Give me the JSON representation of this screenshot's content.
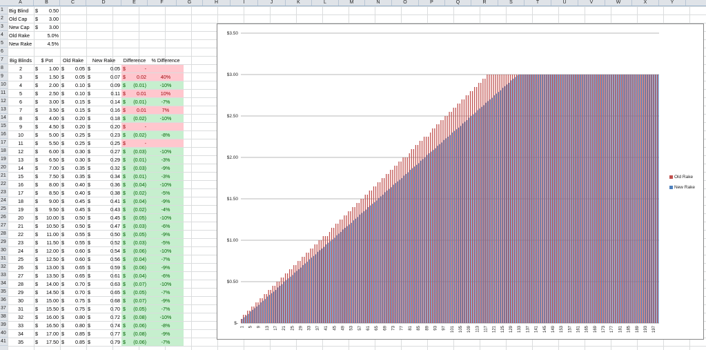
{
  "spreadsheet": {
    "columns": [
      "A",
      "B",
      "C",
      "D",
      "E",
      "F",
      "G",
      "H",
      "I",
      "J",
      "K",
      "L",
      "M",
      "N",
      "O",
      "P",
      "Q",
      "R",
      "S",
      "T",
      "U",
      "V",
      "W",
      "X",
      "Y"
    ],
    "rows": [
      "1",
      "2",
      "3",
      "4",
      "5",
      "6",
      "7",
      "8",
      "9",
      "10",
      "11",
      "12",
      "13",
      "14",
      "15",
      "16",
      "17",
      "18",
      "19",
      "20",
      "21",
      "22",
      "23",
      "24",
      "25",
      "26",
      "27",
      "28",
      "29",
      "30",
      "31",
      "32",
      "33",
      "34",
      "35",
      "36",
      "37",
      "38",
      "39",
      "40",
      "41"
    ],
    "params": [
      {
        "label": "Big Blind",
        "cur": "$",
        "val": "0.50"
      },
      {
        "label": "Old Cap",
        "cur": "$",
        "val": "3.00"
      },
      {
        "label": "New Cap",
        "cur": "$",
        "val": "3.00"
      },
      {
        "label": "Old Rake",
        "cur": "",
        "val": "5.0%"
      },
      {
        "label": "New Rake",
        "cur": "",
        "val": "4.5%"
      }
    ],
    "headers": [
      "Big Blinds",
      "$ Pot",
      "Old Rake",
      "New Rake",
      "Difference",
      "% Difference"
    ],
    "table": [
      {
        "bb": "2",
        "pot": "1.00",
        "old": "0.05",
        "new": "0.05",
        "diff": "-",
        "pct": "",
        "color": "red"
      },
      {
        "bb": "3",
        "pot": "1.50",
        "old": "0.05",
        "new": "0.07",
        "diff": "0.02",
        "pct": "40%",
        "color": "red"
      },
      {
        "bb": "4",
        "pot": "2.00",
        "old": "0.10",
        "new": "0.09",
        "diff": "(0.01)",
        "pct": "-10%",
        "color": "green"
      },
      {
        "bb": "5",
        "pot": "2.50",
        "old": "0.10",
        "new": "0.11",
        "diff": "0.01",
        "pct": "10%",
        "color": "red"
      },
      {
        "bb": "6",
        "pot": "3.00",
        "old": "0.15",
        "new": "0.14",
        "diff": "(0.01)",
        "pct": "-7%",
        "color": "green"
      },
      {
        "bb": "7",
        "pot": "3.50",
        "old": "0.15",
        "new": "0.16",
        "diff": "0.01",
        "pct": "7%",
        "color": "red"
      },
      {
        "bb": "8",
        "pot": "4.00",
        "old": "0.20",
        "new": "0.18",
        "diff": "(0.02)",
        "pct": "-10%",
        "color": "green"
      },
      {
        "bb": "9",
        "pot": "4.50",
        "old": "0.20",
        "new": "0.20",
        "diff": "-",
        "pct": "",
        "color": "red"
      },
      {
        "bb": "10",
        "pot": "5.00",
        "old": "0.25",
        "new": "0.23",
        "diff": "(0.02)",
        "pct": "-8%",
        "color": "green"
      },
      {
        "bb": "11",
        "pot": "5.50",
        "old": "0.25",
        "new": "0.25",
        "diff": "-",
        "pct": "",
        "color": "red"
      },
      {
        "bb": "12",
        "pot": "6.00",
        "old": "0.30",
        "new": "0.27",
        "diff": "(0.03)",
        "pct": "-10%",
        "color": "green"
      },
      {
        "bb": "13",
        "pot": "6.50",
        "old": "0.30",
        "new": "0.29",
        "diff": "(0.01)",
        "pct": "-3%",
        "color": "green"
      },
      {
        "bb": "14",
        "pot": "7.00",
        "old": "0.35",
        "new": "0.32",
        "diff": "(0.03)",
        "pct": "-9%",
        "color": "green"
      },
      {
        "bb": "15",
        "pot": "7.50",
        "old": "0.35",
        "new": "0.34",
        "diff": "(0.01)",
        "pct": "-3%",
        "color": "green"
      },
      {
        "bb": "16",
        "pot": "8.00",
        "old": "0.40",
        "new": "0.36",
        "diff": "(0.04)",
        "pct": "-10%",
        "color": "green"
      },
      {
        "bb": "17",
        "pot": "8.50",
        "old": "0.40",
        "new": "0.38",
        "diff": "(0.02)",
        "pct": "-5%",
        "color": "green"
      },
      {
        "bb": "18",
        "pot": "9.00",
        "old": "0.45",
        "new": "0.41",
        "diff": "(0.04)",
        "pct": "-9%",
        "color": "green"
      },
      {
        "bb": "19",
        "pot": "9.50",
        "old": "0.45",
        "new": "0.43",
        "diff": "(0.02)",
        "pct": "-4%",
        "color": "green"
      },
      {
        "bb": "20",
        "pot": "10.00",
        "old": "0.50",
        "new": "0.45",
        "diff": "(0.05)",
        "pct": "-10%",
        "color": "green"
      },
      {
        "bb": "21",
        "pot": "10.50",
        "old": "0.50",
        "new": "0.47",
        "diff": "(0.03)",
        "pct": "-6%",
        "color": "green"
      },
      {
        "bb": "22",
        "pot": "11.00",
        "old": "0.55",
        "new": "0.50",
        "diff": "(0.05)",
        "pct": "-9%",
        "color": "green"
      },
      {
        "bb": "23",
        "pot": "11.50",
        "old": "0.55",
        "new": "0.52",
        "diff": "(0.03)",
        "pct": "-5%",
        "color": "green"
      },
      {
        "bb": "24",
        "pot": "12.00",
        "old": "0.60",
        "new": "0.54",
        "diff": "(0.06)",
        "pct": "-10%",
        "color": "green"
      },
      {
        "bb": "25",
        "pot": "12.50",
        "old": "0.60",
        "new": "0.56",
        "diff": "(0.04)",
        "pct": "-7%",
        "color": "green"
      },
      {
        "bb": "26",
        "pot": "13.00",
        "old": "0.65",
        "new": "0.59",
        "diff": "(0.06)",
        "pct": "-9%",
        "color": "green"
      },
      {
        "bb": "27",
        "pot": "13.50",
        "old": "0.65",
        "new": "0.61",
        "diff": "(0.04)",
        "pct": "-6%",
        "color": "green"
      },
      {
        "bb": "28",
        "pot": "14.00",
        "old": "0.70",
        "new": "0.63",
        "diff": "(0.07)",
        "pct": "-10%",
        "color": "green"
      },
      {
        "bb": "29",
        "pot": "14.50",
        "old": "0.70",
        "new": "0.65",
        "diff": "(0.05)",
        "pct": "-7%",
        "color": "green"
      },
      {
        "bb": "30",
        "pot": "15.00",
        "old": "0.75",
        "new": "0.68",
        "diff": "(0.07)",
        "pct": "-9%",
        "color": "green"
      },
      {
        "bb": "31",
        "pot": "15.50",
        "old": "0.75",
        "new": "0.70",
        "diff": "(0.05)",
        "pct": "-7%",
        "color": "green"
      },
      {
        "bb": "32",
        "pot": "16.00",
        "old": "0.80",
        "new": "0.72",
        "diff": "(0.08)",
        "pct": "-10%",
        "color": "green"
      },
      {
        "bb": "33",
        "pot": "16.50",
        "old": "0.80",
        "new": "0.74",
        "diff": "(0.06)",
        "pct": "-8%",
        "color": "green"
      },
      {
        "bb": "34",
        "pot": "17.00",
        "old": "0.85",
        "new": "0.77",
        "diff": "(0.08)",
        "pct": "-9%",
        "color": "green"
      },
      {
        "bb": "35",
        "pot": "17.50",
        "old": "0.85",
        "new": "0.79",
        "diff": "(0.06)",
        "pct": "-7%",
        "color": "green"
      }
    ]
  },
  "colors": {
    "old_rake": "#c0504d",
    "new_rake": "#4f81bd",
    "fill_red": "#ffc7ce",
    "fill_green": "#c6efce",
    "text_red": "#9c0006",
    "text_green": "#006100"
  },
  "chart_data": {
    "type": "bar",
    "title": "",
    "xlabel": "",
    "ylabel": "",
    "ylim": [
      0,
      3.5
    ],
    "y_tick_labels": [
      "$-",
      "$0.50",
      "$1.00",
      "$1.50",
      "$2.00",
      "$2.50",
      "$3.00",
      "$3.50"
    ],
    "y_tick_values": [
      0,
      0.5,
      1.0,
      1.5,
      2.0,
      2.5,
      3.0,
      3.5
    ],
    "x_tick_labels": [
      "1",
      "5",
      "9",
      "13",
      "17",
      "21",
      "25",
      "29",
      "33",
      "37",
      "41",
      "45",
      "49",
      "53",
      "57",
      "61",
      "65",
      "69",
      "73",
      "77",
      "81",
      "85",
      "89",
      "93",
      "97",
      "101",
      "105",
      "109",
      "113",
      "117",
      "121",
      "125",
      "129",
      "133",
      "137",
      "141",
      "145",
      "149",
      "153",
      "157",
      "161",
      "165",
      "169",
      "173",
      "177",
      "181",
      "185",
      "189",
      "193",
      "197"
    ],
    "categories_range": [
      1,
      199
    ],
    "old_rake_rule": {
      "pot_per_category": 0.5,
      "pot_offset": 0.5,
      "rate": 0.05,
      "round_to": 0.05,
      "cap": 3.0
    },
    "new_rake_rule": {
      "pot_per_category": 0.5,
      "pot_offset": 0.5,
      "rate": 0.045,
      "round_to": 0.01,
      "cap": 3.0
    },
    "legend_position": "right",
    "series": [
      {
        "name": "Old Rake"
      },
      {
        "name": "New Rake"
      }
    ],
    "grid": true
  }
}
